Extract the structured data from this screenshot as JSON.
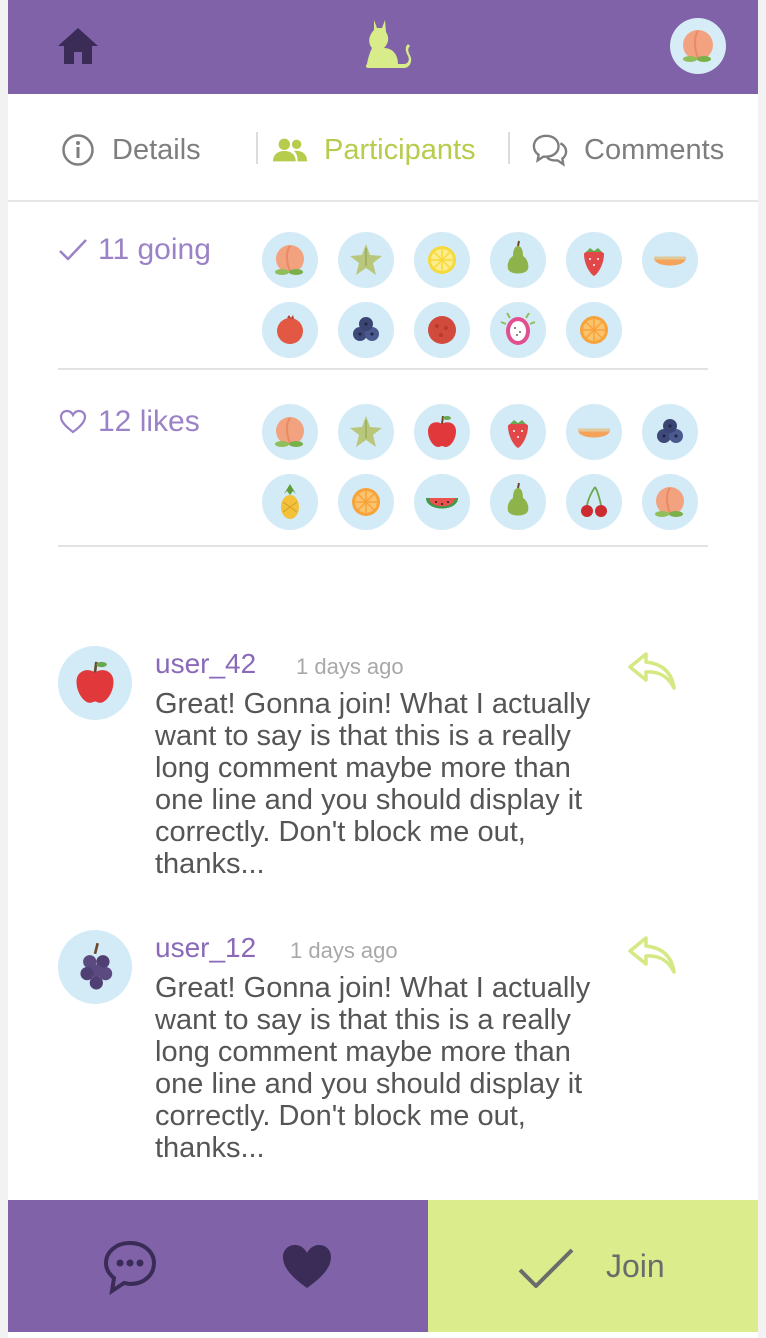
{
  "header": {
    "home_icon": "home-icon",
    "logo_icon": "cat-icon",
    "avatar_icon": "peach-icon"
  },
  "tabs": [
    {
      "label": "Details",
      "icon": "info-icon",
      "active": false
    },
    {
      "label": "Participants",
      "icon": "people-icon",
      "active": true
    },
    {
      "label": "Comments",
      "icon": "comments-icon",
      "active": false
    }
  ],
  "colors": {
    "brand_purple": "#8062a8",
    "accent_green": "#b5cc4d",
    "join_bg": "#dbec8c",
    "label_purple": "#9b82c6",
    "avatar_bg": "#d3eaf7"
  },
  "going": {
    "label": "11 going",
    "icon": "check-icon",
    "avatars": [
      "peach",
      "starfruit",
      "lemon",
      "pear",
      "strawberry",
      "cantaloupe",
      "pomegranate",
      "blueberry",
      "lychee",
      "dragonfruit",
      "orange"
    ]
  },
  "likes": {
    "label": "12 likes",
    "icon": "heart-outline-icon",
    "avatars": [
      "peach",
      "starfruit",
      "apple",
      "strawberry",
      "cantaloupe",
      "blueberry",
      "pineapple",
      "orange",
      "watermelon",
      "pear",
      "cherry",
      "peach"
    ]
  },
  "comments": [
    {
      "user": "user_42",
      "time": "1 days ago",
      "avatar": "apple",
      "text": "Great! Gonna join! What I actually want to say is that this is a really long comment maybe more than one line and you should display it correctly. Don't block me out, thanks...",
      "reply_icon": "reply-icon"
    },
    {
      "user": "user_12",
      "time": "1 days ago",
      "avatar": "grapes",
      "text": "Great! Gonna join! What I actually want to say is that this is a really long comment maybe more than one line and you should display it correctly. Don't block me out, thanks...",
      "reply_icon": "reply-icon"
    }
  ],
  "bottom_bar": {
    "comment_icon": "chat-bubble-icon",
    "like_icon": "heart-icon",
    "join_icon": "check-icon",
    "join_label": "Join"
  }
}
